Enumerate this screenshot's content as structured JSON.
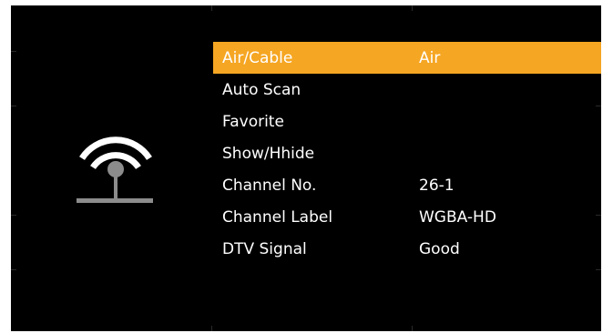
{
  "menu": {
    "items": [
      {
        "label": "Air/Cable",
        "value": "Air"
      },
      {
        "label": "Auto Scan",
        "value": ""
      },
      {
        "label": "Favorite",
        "value": ""
      },
      {
        "label": "Show/Hhide",
        "value": ""
      },
      {
        "label": "Channel No.",
        "value": "26-1"
      },
      {
        "label": "Channel Label",
        "value": "WGBA-HD"
      },
      {
        "label": "DTV Signal",
        "value": "Good"
      }
    ],
    "selected_index": 0
  },
  "icon": "antenna-signal-icon",
  "colors": {
    "background": "#000000",
    "highlight": "#f5a623",
    "text": "#ffffff",
    "icon_light": "#ffffff",
    "icon_gray": "#8c8c8c"
  }
}
